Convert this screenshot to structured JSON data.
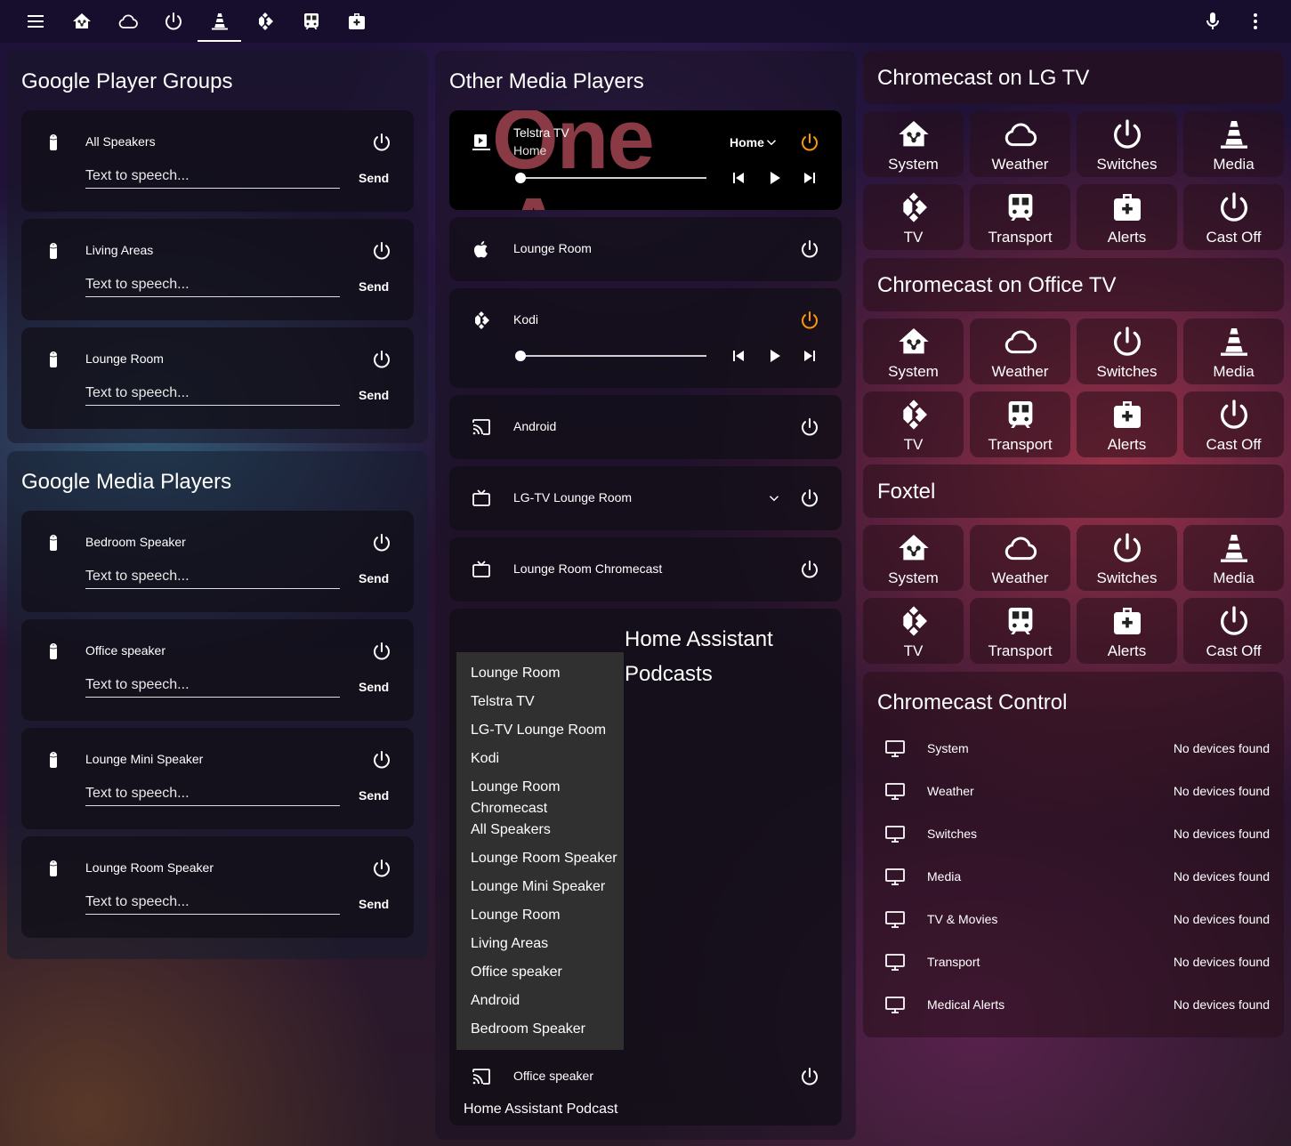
{
  "topbar": {
    "tabs": [
      {
        "icon": "menu-icon"
      },
      {
        "icon": "home-automation-icon"
      },
      {
        "icon": "cloud-icon"
      },
      {
        "icon": "power-icon"
      },
      {
        "icon": "cone-icon"
      },
      {
        "icon": "kodi-icon"
      },
      {
        "icon": "train-icon"
      },
      {
        "icon": "medical-bag-icon"
      }
    ],
    "active_tab": "cone-icon",
    "right_icons": [
      "microphone-icon",
      "dots-vertical-icon"
    ]
  },
  "player_groups": {
    "title": "Google Player Groups",
    "items": [
      {
        "name": "All Speakers",
        "placeholder": "Text to speech...",
        "send": "Send"
      },
      {
        "name": "Living Areas",
        "placeholder": "Text to speech...",
        "send": "Send"
      },
      {
        "name": "Lounge Room",
        "placeholder": "Text to speech...",
        "send": "Send"
      }
    ]
  },
  "media_players": {
    "title": "Google Media Players",
    "items": [
      {
        "name": "Bedroom Speaker",
        "placeholder": "Text to speech...",
        "send": "Send"
      },
      {
        "name": "Office speaker",
        "placeholder": "Text to speech...",
        "send": "Send"
      },
      {
        "name": "Lounge Mini Speaker",
        "placeholder": "Text to speech...",
        "send": "Send"
      },
      {
        "name": "Lounge Room Speaker",
        "placeholder": "Text to speech...",
        "send": "Send"
      }
    ]
  },
  "other_players": {
    "title": "Other Media Players",
    "telstra": {
      "name": "Telstra TV",
      "subtitle": "Home",
      "source": "Home",
      "bg_text_1": "One",
      "bg_text_2": "App",
      "progress": 0
    },
    "lounge_room": {
      "name": "Lounge Room"
    },
    "kodi": {
      "name": "Kodi",
      "progress": 0
    },
    "android": {
      "name": "Android"
    },
    "lg_tv": {
      "name": "LG-TV Lounge Room"
    },
    "lounge_chromecast": {
      "name": "Lounge Room Chromecast"
    },
    "podcast": {
      "title_line1": "Home Assistant",
      "title_line2": "Podcasts",
      "dropdown": [
        "Lounge Room",
        "Telstra TV",
        "LG-TV Lounge Room",
        "Kodi",
        "Lounge Room Chromecast",
        "All Speakers",
        "Lounge Room Speaker",
        "Lounge Mini Speaker",
        "Lounge Room",
        "Living Areas",
        "Office speaker",
        "Android",
        "Bedroom Speaker"
      ],
      "player_name": "Office speaker",
      "footer": "Home Assistant Podcast"
    }
  },
  "cast_sections": [
    {
      "title": "Chromecast on LG TV"
    },
    {
      "title": "Chromecast on Office TV"
    },
    {
      "title": "Foxtel"
    }
  ],
  "tiles": [
    "System",
    "Weather",
    "Switches",
    "Media",
    "TV",
    "Transport",
    "Alerts",
    "Cast Off"
  ],
  "chromecast_control": {
    "title": "Chromecast Control",
    "rows": [
      {
        "name": "System",
        "status": "No devices found"
      },
      {
        "name": "Weather",
        "status": "No devices found"
      },
      {
        "name": "Switches",
        "status": "No devices found"
      },
      {
        "name": "Media",
        "status": "No devices found"
      },
      {
        "name": "TV & Movies",
        "status": "No devices found"
      },
      {
        "name": "Transport",
        "status": "No devices found"
      },
      {
        "name": "Medical Alerts",
        "status": "No devices found"
      }
    ]
  },
  "colors": {
    "accent": "#ff9800",
    "active_tab_line": "#ffffff"
  }
}
